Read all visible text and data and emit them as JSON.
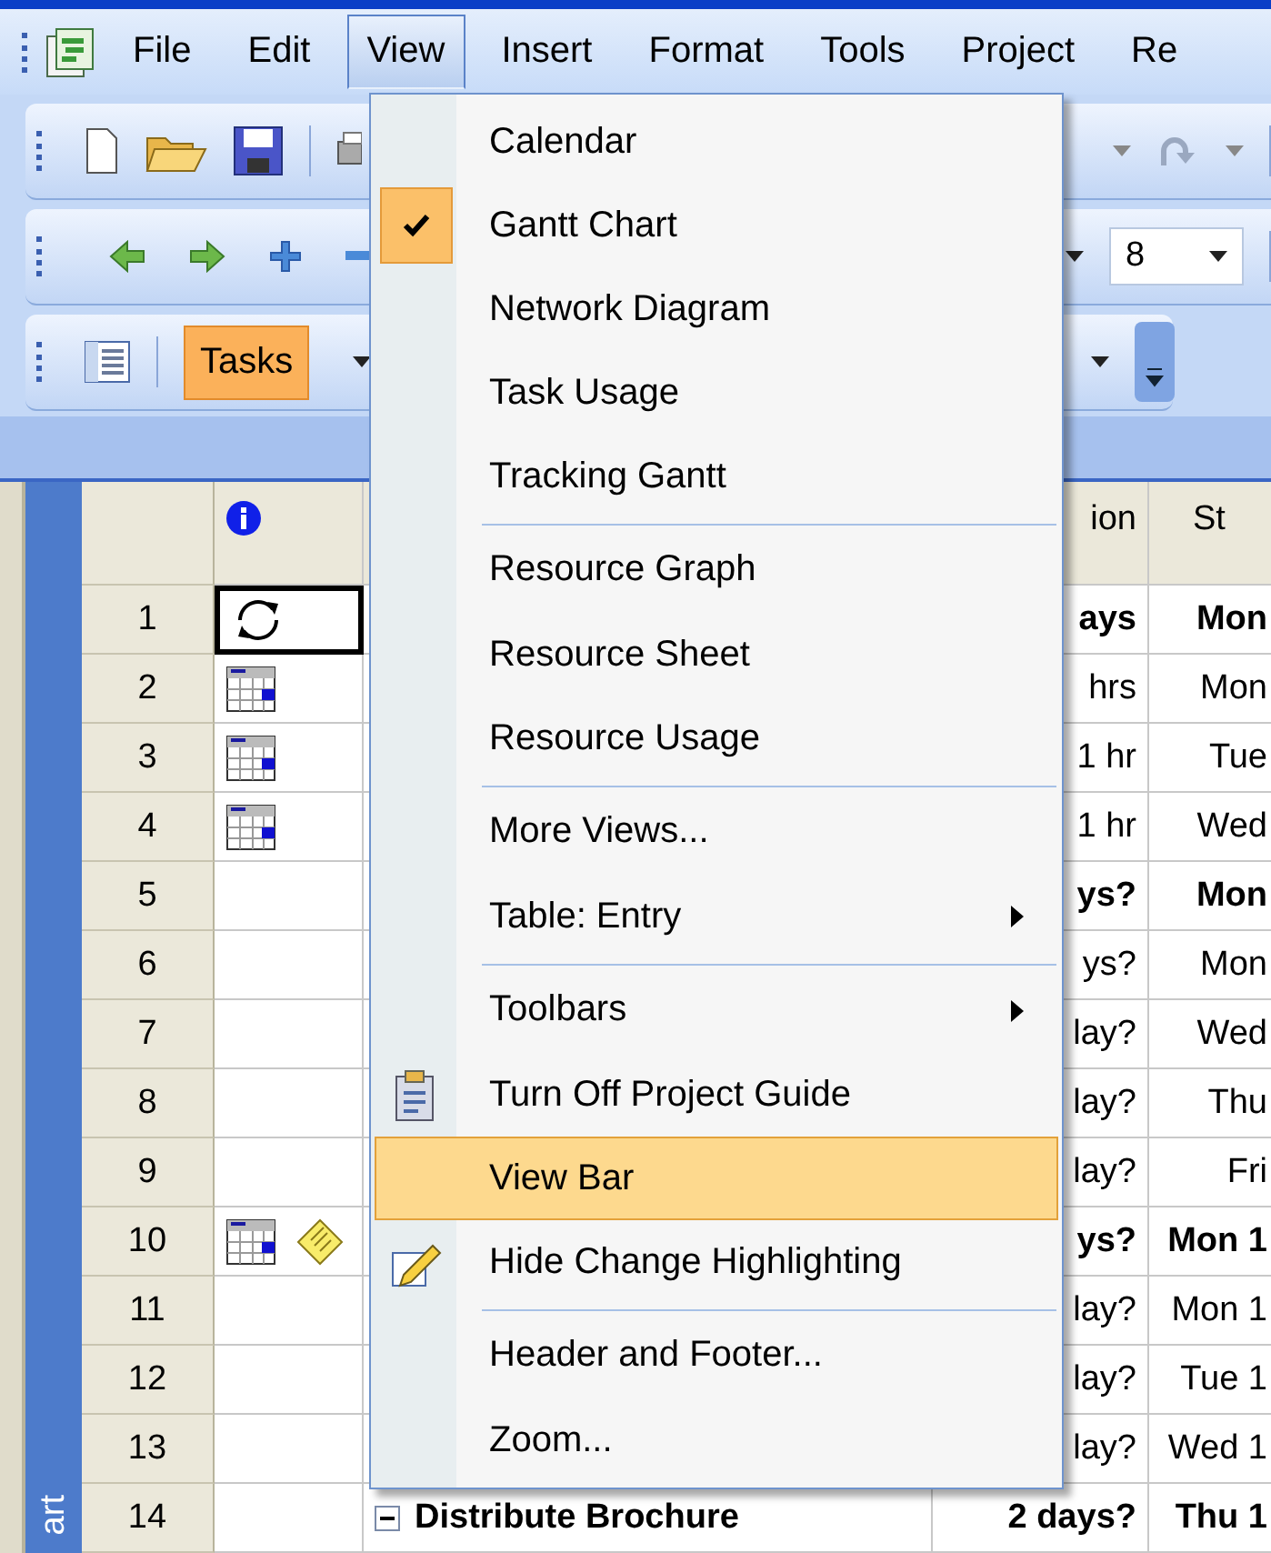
{
  "menubar": [
    {
      "label": "File",
      "selected": false
    },
    {
      "label": "Edit",
      "selected": false
    },
    {
      "label": "View",
      "selected": true
    },
    {
      "label": "Insert",
      "selected": false
    },
    {
      "label": "Format",
      "selected": false
    },
    {
      "label": "Tools",
      "selected": false
    },
    {
      "label": "Project",
      "selected": false
    },
    {
      "label": "Re",
      "selected": false
    }
  ],
  "task_button": {
    "label": "Tasks",
    "selected": true
  },
  "font_size_field": {
    "value": "8"
  },
  "view_bar": {
    "label": "art"
  },
  "table": {
    "columns": [
      "ion",
      "St"
    ],
    "rows": [
      {
        "number": "1",
        "indicators": [
          {
            "kind": "recurring"
          }
        ],
        "selected": true,
        "summary": true,
        "duration": "ays",
        "start": "Mon"
      },
      {
        "number": "2",
        "indicators": [
          {
            "kind": "calendar"
          }
        ],
        "selected": false,
        "summary": false,
        "duration": "hrs",
        "start": "Mon"
      },
      {
        "number": "3",
        "indicators": [
          {
            "kind": "calendar"
          }
        ],
        "selected": false,
        "summary": false,
        "duration": "1 hr",
        "start": "Tue"
      },
      {
        "number": "4",
        "indicators": [
          {
            "kind": "calendar"
          }
        ],
        "selected": false,
        "summary": false,
        "duration": "1 hr",
        "start": "Wed"
      },
      {
        "number": "5",
        "indicators": [],
        "selected": false,
        "summary": true,
        "duration": "ys?",
        "start": "Mon"
      },
      {
        "number": "6",
        "indicators": [],
        "selected": false,
        "summary": false,
        "duration": "ys?",
        "start": "Mon"
      },
      {
        "number": "7",
        "indicators": [],
        "selected": false,
        "summary": false,
        "duration": "lay?",
        "start": "Wed"
      },
      {
        "number": "8",
        "indicators": [],
        "selected": false,
        "summary": false,
        "duration": "lay?",
        "start": "Thu"
      },
      {
        "number": "9",
        "indicators": [],
        "selected": false,
        "summary": false,
        "duration": "lay?",
        "start": "Fri"
      },
      {
        "number": "10",
        "indicators": [
          {
            "kind": "calendar"
          },
          {
            "kind": "note"
          }
        ],
        "selected": false,
        "summary": true,
        "duration": "ys?",
        "start": "Mon 1"
      },
      {
        "number": "11",
        "indicators": [],
        "selected": false,
        "summary": false,
        "duration": "lay?",
        "start": "Mon 1"
      },
      {
        "number": "12",
        "indicators": [],
        "selected": false,
        "summary": false,
        "duration": "lay?",
        "start": "Tue 1"
      },
      {
        "number": "13",
        "indicators": [],
        "selected": false,
        "summary": false,
        "duration": "lay?",
        "start": "Wed 1"
      },
      {
        "number": "14",
        "indicators": [],
        "selected": false,
        "summary": true,
        "expanded": true,
        "name": "Distribute Brochure",
        "duration": "2 days?",
        "start": "Thu 1"
      }
    ]
  },
  "view_menu": {
    "items": [
      {
        "label": "Calendar",
        "checked": false,
        "selected": false,
        "submenu": false,
        "separator_before": false
      },
      {
        "label": "Gantt Chart",
        "checked": true,
        "selected": false,
        "submenu": false,
        "separator_before": false
      },
      {
        "label": "Network Diagram",
        "checked": false,
        "selected": false,
        "submenu": false,
        "separator_before": false
      },
      {
        "label": "Task Usage",
        "checked": false,
        "selected": false,
        "submenu": false,
        "separator_before": false
      },
      {
        "label": "Tracking Gantt",
        "checked": false,
        "selected": false,
        "submenu": false,
        "separator_before": false
      },
      {
        "label": "Resource Graph",
        "checked": false,
        "selected": false,
        "submenu": false,
        "separator_before": true
      },
      {
        "label": "Resource Sheet",
        "checked": false,
        "selected": false,
        "submenu": false,
        "separator_before": false
      },
      {
        "label": "Resource Usage",
        "checked": false,
        "selected": false,
        "submenu": false,
        "separator_before": false
      },
      {
        "label": "More Views...",
        "checked": false,
        "selected": false,
        "submenu": false,
        "separator_before": true
      },
      {
        "label": "Table: Entry",
        "checked": false,
        "selected": false,
        "submenu": true,
        "separator_before": false
      },
      {
        "label": "Toolbars",
        "checked": false,
        "selected": false,
        "submenu": true,
        "separator_before": true
      },
      {
        "label": "Turn Off Project Guide",
        "checked": false,
        "selected": false,
        "submenu": false,
        "separator_before": false,
        "kind": "guide"
      },
      {
        "label": "View Bar",
        "checked": false,
        "selected": true,
        "submenu": false,
        "separator_before": false
      },
      {
        "label": "Hide Change Highlighting",
        "checked": false,
        "selected": false,
        "submenu": false,
        "separator_before": false,
        "kind": "highlighter"
      },
      {
        "label": "Header and Footer...",
        "checked": false,
        "selected": false,
        "submenu": false,
        "separator_before": true
      },
      {
        "label": "Zoom...",
        "checked": false,
        "selected": false,
        "submenu": false,
        "separator_before": false
      }
    ]
  }
}
